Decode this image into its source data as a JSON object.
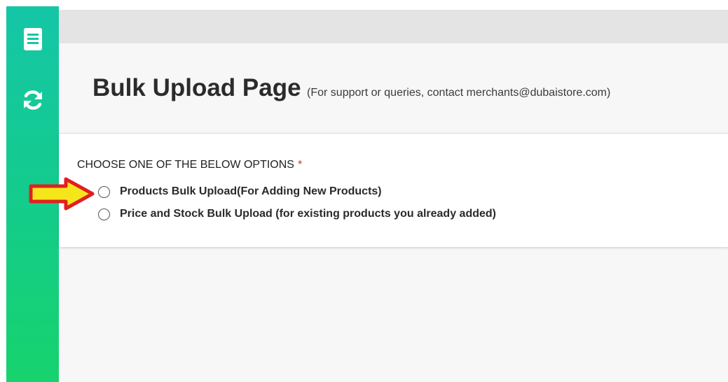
{
  "sidebar": {
    "icons": [
      {
        "name": "document-icon"
      },
      {
        "name": "sync-icon"
      }
    ]
  },
  "header": {
    "title": "Bulk Upload Page",
    "subtitle": "(For support or queries, contact merchants@dubaistore.com)"
  },
  "form": {
    "question": "CHOOSE ONE OF THE BELOW OPTIONS",
    "required_mark": "*",
    "options": [
      {
        "label": "Products Bulk Upload(For Adding New Products)",
        "selected": false
      },
      {
        "label": "Price and Stock Bulk Upload (for existing products you already added)",
        "selected": false
      }
    ]
  },
  "annotation": {
    "arrow_fill": "#f5e61b",
    "arrow_stroke": "#e02020"
  },
  "colors": {
    "sidebar_top": "#15c6a7",
    "sidebar_bottom": "#17d36d",
    "required": "#c0392b"
  }
}
